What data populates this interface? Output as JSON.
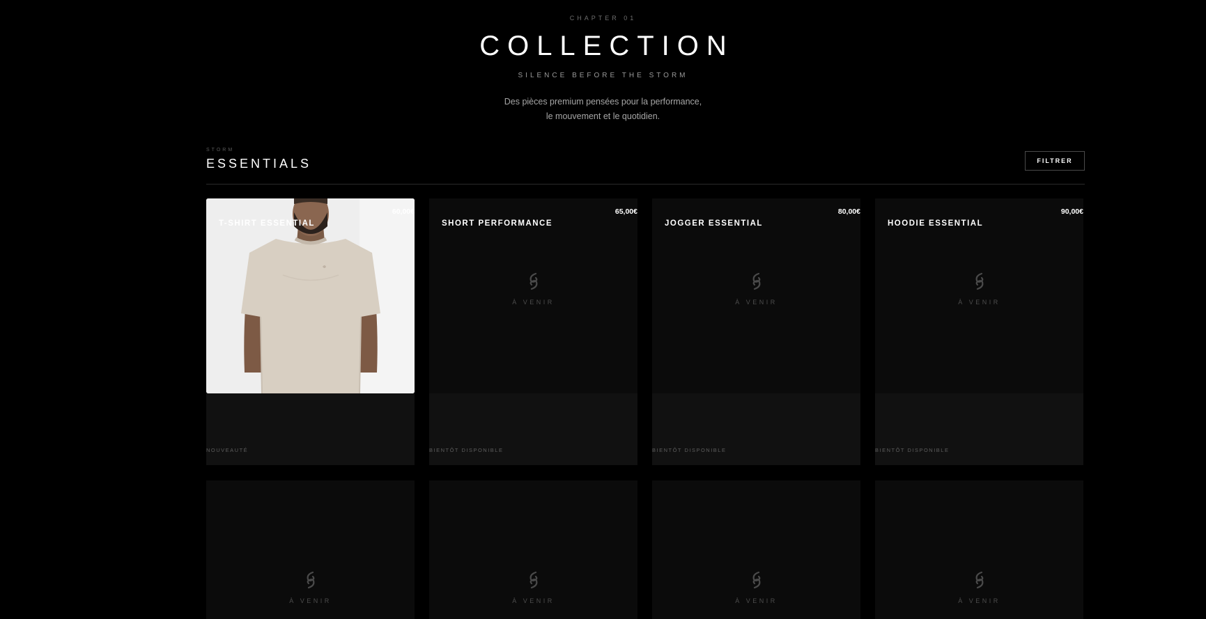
{
  "hero": {
    "chapter": "CHAPTER 01",
    "title": "COLLECTION",
    "subtitle": "SILENCE BEFORE THE STORM",
    "description_line1": "Des pièces premium pensées pour la performance,",
    "description_line2": "le mouvement et le quotidien."
  },
  "section": {
    "kicker": "STORM",
    "title": "ESSENTIALS",
    "filter_label": "FILTRER"
  },
  "products": [
    {
      "name": "T-SHIRT ESSENTIAL",
      "price": "60,00€",
      "status": "NOUVEAUTÉ",
      "image": "photo"
    },
    {
      "name": "SHORT PERFORMANCE",
      "price": "65,00€",
      "status": "BIENTÔT DISPONIBLE",
      "placeholder": "À VENIR"
    },
    {
      "name": "JOGGER ESSENTIAL",
      "price": "80,00€",
      "status": "BIENTÔT DISPONIBLE",
      "placeholder": "À VENIR"
    },
    {
      "name": "HOODIE ESSENTIAL",
      "price": "90,00€",
      "status": "BIENTÔT DISPONIBLE",
      "placeholder": "À VENIR"
    }
  ],
  "products_row2": [
    {
      "placeholder": "À VENIR"
    },
    {
      "placeholder": "À VENIR"
    },
    {
      "placeholder": "À VENIR"
    },
    {
      "placeholder": "À VENIR"
    }
  ],
  "colors": {
    "background": "#000000",
    "card": "#0b0b0b",
    "card_info": "#111111",
    "text": "#ffffff",
    "muted": "#5e5e5e"
  },
  "icons": {
    "placeholder": "storm-logo-icon"
  }
}
